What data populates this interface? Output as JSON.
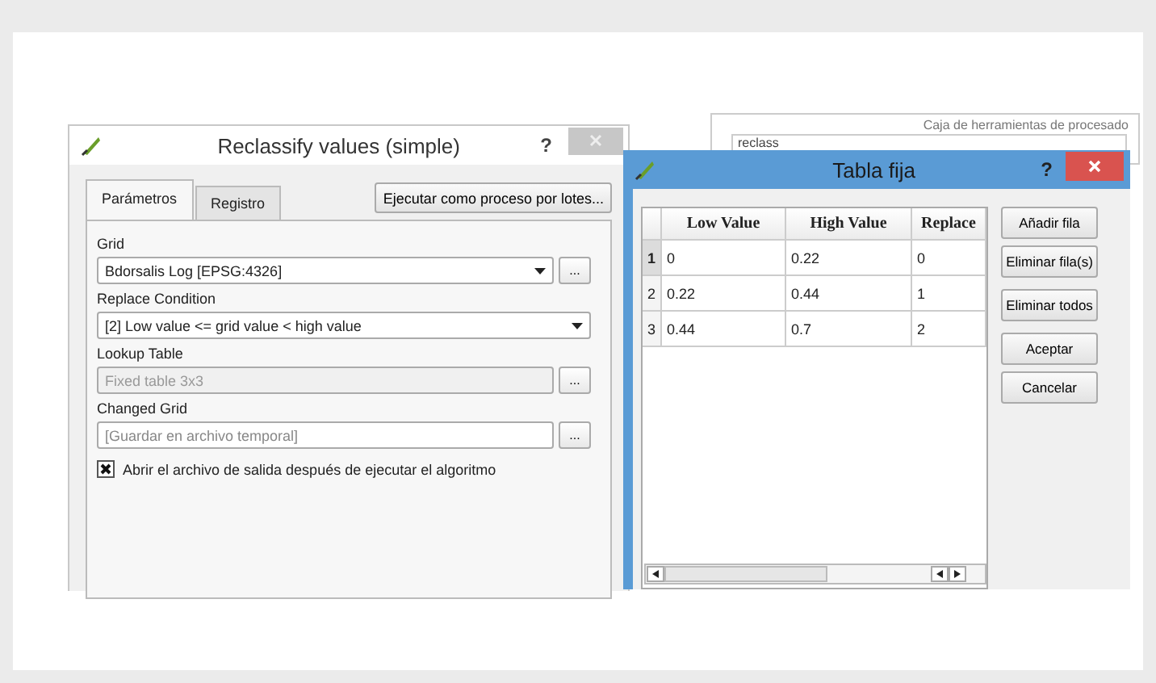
{
  "background_window": {
    "title": "Caja de herramientas de procesado",
    "search": {
      "value": "reclass"
    }
  },
  "dialog": {
    "title": "Reclassify values (simple)",
    "help": "?",
    "tabs": [
      {
        "label": "Parámetros",
        "selected": true
      },
      {
        "label": "Registro",
        "selected": false
      }
    ],
    "batch_button": "Ejecutar como proceso por lotes...",
    "fields": [
      {
        "kind": "combo",
        "label": "Grid",
        "value": "Bdorsalis Log [EPSG:4326]",
        "browse": "...",
        "disabled": false
      },
      {
        "kind": "combo",
        "label": "Replace Condition",
        "value": "[2] Low value <= grid value < high value",
        "disabled": false
      },
      {
        "kind": "text",
        "label": "Lookup Table",
        "value": "Fixed table 3x3",
        "browse": "...",
        "disabled": true
      },
      {
        "kind": "text",
        "label": "Changed Grid",
        "placeholder": "[Guardar en archivo temporal]",
        "browse": "...",
        "disabled": false
      }
    ],
    "checkbox": {
      "label": "Abrir el archivo de salida después de ejecutar el algoritmo",
      "checked": true
    }
  },
  "table_dialog": {
    "title": "Tabla fija",
    "help": "?",
    "columns": [
      "Low Value",
      "High Value",
      "Replace"
    ],
    "rows": [
      {
        "number": "1",
        "current": true,
        "cells": [
          "0",
          "0.22",
          "0"
        ]
      },
      {
        "number": "2",
        "current": false,
        "cells": [
          "0.22",
          "0.44",
          "1"
        ]
      },
      {
        "number": "3",
        "current": false,
        "cells": [
          "0.44",
          "0.7",
          "2"
        ]
      }
    ],
    "buttons": [
      "Añadir fila",
      "Eliminar fila(s)",
      "Eliminar todos",
      "Aceptar",
      "Cancelar"
    ]
  }
}
